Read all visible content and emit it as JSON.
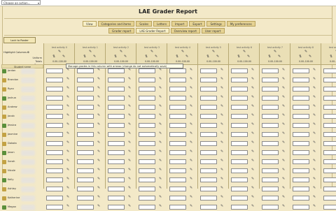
{
  "topbar": {
    "select_value": "Choose an action..."
  },
  "page_title": "LAE Grader Report",
  "nav": {
    "primary": [
      "View",
      "Categories and items",
      "Scales",
      "Letters",
      "Import",
      "Export",
      "Settings",
      "My preferences"
    ],
    "secondary": [
      "Grader report",
      "LAE Grader Report",
      "Overview report",
      "User report"
    ]
  },
  "controls": {
    "lock_button": "Lock to Roster",
    "highlight_label": "Highlight Columns",
    "highlight_value": "0"
  },
  "stats": {
    "labels": [
      "Uniform",
      "Totals",
      "Range",
      "Show Hidden"
    ]
  },
  "students_header": "Student name",
  "columns": [
    {
      "name": "test activity 0",
      "range": "0.00–100.00"
    },
    {
      "name": "test activity 1",
      "range": "0.00–100.00"
    },
    {
      "name": "test activity 2",
      "range": "0.00–100.00"
    },
    {
      "name": "test activity 3",
      "range": "0.00–100.00"
    },
    {
      "name": "test activity 4",
      "range": "0.00–100.00"
    },
    {
      "name": "test activity 5",
      "range": "0.00–100.00"
    },
    {
      "name": "test activity 6",
      "range": "0.00–100.00"
    },
    {
      "name": "test activity 7",
      "range": "0.00–100.00"
    },
    {
      "name": "test activity 8",
      "range": "0.00–100.00"
    },
    {
      "name": "test activity 9",
      "range": "0.00–100.00"
    }
  ],
  "students": [
    "Jordan",
    "Brandon",
    "Ryan",
    "Joshua",
    "Andrew",
    "Jacob",
    "Jessica",
    "Jasmine",
    "Dakota",
    "Jason",
    "Sarah",
    "Nicole",
    "Kelly",
    "Ashley",
    "Katherine",
    "Megan"
  ],
  "tooltip": "Manage grades in this column with arrows (change do not automatically save)"
}
